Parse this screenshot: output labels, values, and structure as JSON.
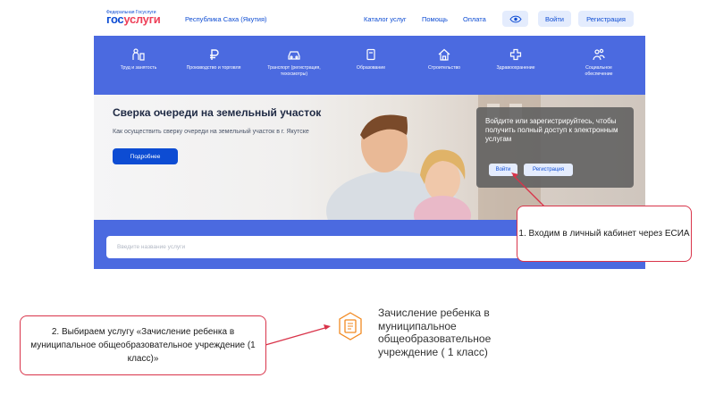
{
  "header": {
    "logo_superscript": "Федеральная Госуслуги",
    "logo_part1": "гос",
    "logo_part2": "услуги",
    "region": "Республика Саха (Якутия)",
    "nav": [
      "Каталог услуг",
      "Помощь",
      "Оплата"
    ],
    "login_label": "Войти",
    "register_label": "Регистрация"
  },
  "categories": [
    {
      "label": "Труд и занятость",
      "icon": "worker-icon"
    },
    {
      "label": "Производство и торговля",
      "icon": "ruble-icon"
    },
    {
      "label": "Транспорт (регистрация,\nтехосмотры)",
      "icon": "car-icon"
    },
    {
      "label": "Образование",
      "icon": "book-icon"
    },
    {
      "label": "Строительство",
      "icon": "house-icon"
    },
    {
      "label": "Здравоохранение",
      "icon": "medical-cross-icon"
    },
    {
      "label": "Социальное\nобеспечение",
      "icon": "people-icon"
    }
  ],
  "hero": {
    "title": "Сверка очереди на земельный участок",
    "subtitle": "Как осуществить сверку очереди на земельный участок в г. Якутске",
    "more_button": "Подробнее",
    "login_prompt": "Войдите или зарегистрируйтесь, чтобы получить полный доступ к электронным услугам",
    "login_button": "Войти",
    "register_button": "Регистрация"
  },
  "search": {
    "placeholder": "Введите название услуги"
  },
  "callouts": {
    "step1": "1. Входим в личный кабинет через ЕСИА",
    "step2": "2. Выбираем услугу «Зачисление ребенка в муниципальное общеобразовательное учреждение (1 класс)»"
  },
  "service": {
    "label": "Зачисление ребенка в муниципальное общеобразовательное учреждение ( 1 класс)",
    "icon": "school-document-icon"
  },
  "colors": {
    "brand_blue": "#0d4cd3",
    "band_blue": "#4b6ae0",
    "logo_red": "#ee3f58",
    "callout_border": "#d9344a",
    "service_icon": "#f28a22"
  }
}
